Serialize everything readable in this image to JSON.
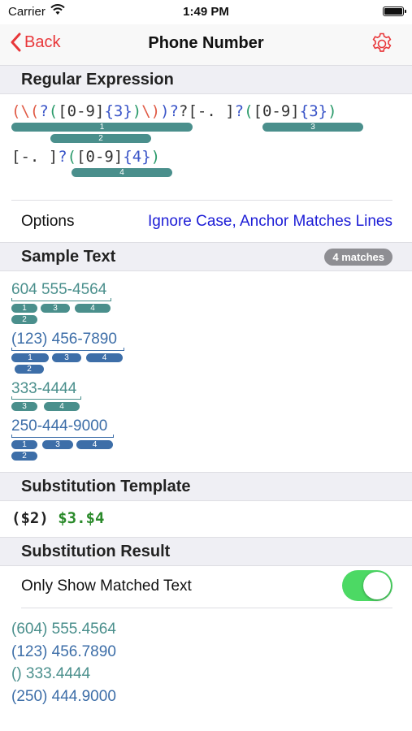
{
  "status_bar": {
    "carrier": "Carrier",
    "time": "1:49 PM"
  },
  "nav": {
    "back_label": "Back",
    "title": "Phone Number"
  },
  "regex_section": {
    "header": "Regular Expression",
    "group_labels": [
      "1",
      "2",
      "3",
      "4"
    ]
  },
  "options": {
    "label": "Options",
    "value": "Ignore Case, Anchor Matches Lines"
  },
  "sample_section": {
    "header": "Sample Text",
    "match_count": "4 matches",
    "lines": [
      {
        "text": "604 555-4564",
        "groups": [
          "1",
          "3",
          "4",
          "2"
        ]
      },
      {
        "text": "(123) 456-7890",
        "groups": [
          "1",
          "3",
          "4",
          "2"
        ]
      },
      {
        "text": "333-4444",
        "groups": [
          "3",
          "4"
        ]
      },
      {
        "text": "250-444-9000",
        "groups": [
          "1",
          "3",
          "4",
          "2"
        ]
      }
    ]
  },
  "substitution_template": {
    "header": "Substitution Template",
    "part1": "($2) ",
    "part2": "$3.$4"
  },
  "substitution_result": {
    "header": "Substitution Result",
    "toggle_label": "Only Show Matched Text",
    "toggle_on": true,
    "results": [
      "(604) 555.4564",
      "(123) 456.7890",
      "() 333.4444",
      "(250) 444.9000"
    ]
  },
  "colors": {
    "accent": "#e8373a",
    "teal": "#4a8f8c",
    "blue": "#3d6ea8",
    "switch_on": "#4cd964"
  }
}
